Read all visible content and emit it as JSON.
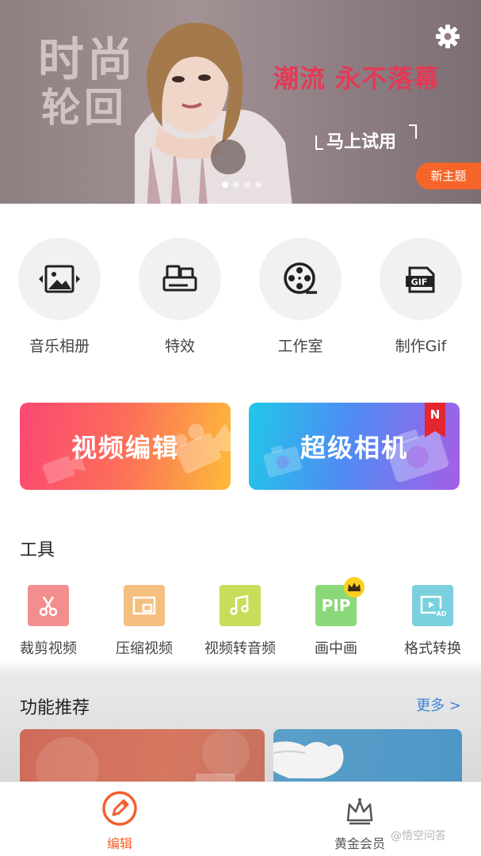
{
  "banner": {
    "headline_line1": "时尚",
    "headline_line2": "轮回",
    "slogan": "潮流 永不落幕",
    "cta": "马上试用",
    "new_theme_badge": "新主题",
    "icons": {
      "settings": "gear-icon"
    }
  },
  "functions": [
    {
      "label": "音乐相册",
      "icon": "music-album-icon"
    },
    {
      "label": "特效",
      "icon": "effects-icon"
    },
    {
      "label": "工作室",
      "icon": "film-reel-icon"
    },
    {
      "label": "制作Gif",
      "icon": "gif-icon"
    }
  ],
  "cards": {
    "video_edit": "视频编辑",
    "super_camera": "超级相机",
    "new_badge": "N"
  },
  "tools": {
    "title": "工具",
    "items": [
      {
        "label": "裁剪视频",
        "icon": "scissors-icon",
        "color": "#f28e8e"
      },
      {
        "label": "压缩视频",
        "icon": "compress-icon",
        "color": "#f5bf80"
      },
      {
        "label": "视频转音频",
        "icon": "music-note-icon",
        "color": "#c6de5a"
      },
      {
        "label": "画中画",
        "icon": "pip-icon",
        "color": "#8ad87a"
      },
      {
        "label": "格式转换",
        "icon": "format-convert-icon",
        "color": "#7ad0de"
      }
    ]
  },
  "recommend": {
    "title": "功能推荐",
    "more": "更多 >"
  },
  "bottom_nav": {
    "edit": "编辑",
    "vip": "黄金会员"
  },
  "watermark": "@悟空问答",
  "colors": {
    "accent": "#f2602f",
    "link": "#3f86d8"
  }
}
